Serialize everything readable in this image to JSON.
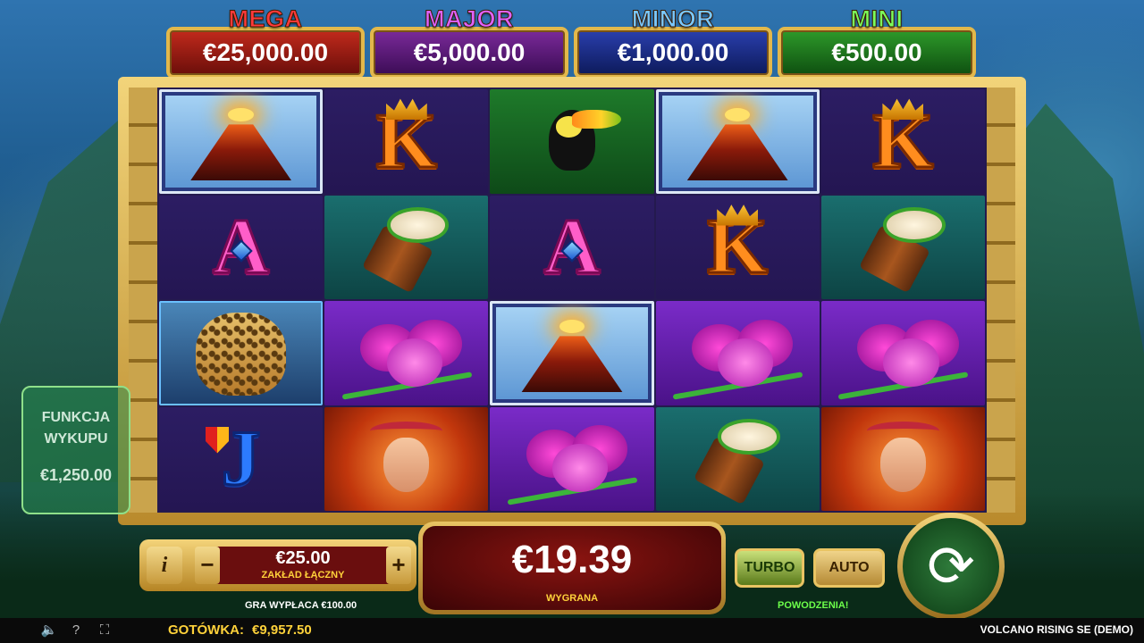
{
  "jackpots": [
    {
      "name": "MEGA",
      "value": "€25,000.00"
    },
    {
      "name": "MAJOR",
      "value": "€5,000.00"
    },
    {
      "name": "MINOR",
      "value": "€1,000.00"
    },
    {
      "name": "MINI",
      "value": "€500.00"
    }
  ],
  "reels": [
    [
      "volcano",
      "A",
      "jaguar",
      "J"
    ],
    [
      "K",
      "drum",
      "orchid",
      "goddess"
    ],
    [
      "toucan",
      "A",
      "volcano",
      "orchid"
    ],
    [
      "volcano",
      "K",
      "orchid",
      "drum"
    ],
    [
      "K",
      "drum",
      "orchid",
      "goddess"
    ]
  ],
  "buy_feature": {
    "line1": "FUNKCJA",
    "line2": "WYKUPU",
    "price": "€1,250.00"
  },
  "controls": {
    "info": "i",
    "minus": "−",
    "plus": "+",
    "bet_value": "€25.00",
    "bet_label": "ZAKŁAD ŁĄCZNY",
    "win_value": "€19.39",
    "win_label": "WYGRANA",
    "turbo": "TURBO",
    "auto": "AUTO",
    "spin_icon": "spin-arrows-icon",
    "spin_glyph": "⟳"
  },
  "status": {
    "payout": "GRA WYPŁACA €100.00",
    "good_luck": "POWODZENIA!"
  },
  "footer": {
    "sound_icon": "🔈",
    "help_icon": "?",
    "fullscreen_icon": "⛶",
    "cash_label": "GOTÓWKA:",
    "cash_value": "€9,957.50",
    "game_title": "VOLCANO RISING SE (DEMO)"
  }
}
